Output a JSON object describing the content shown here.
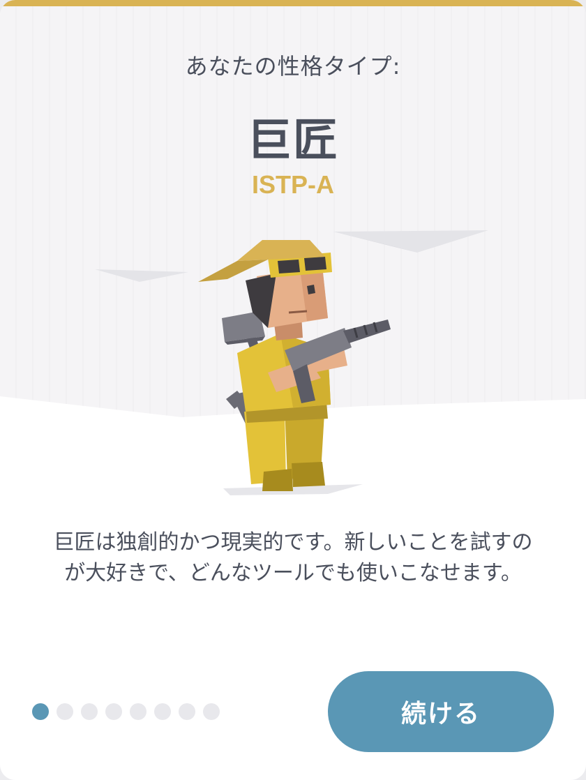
{
  "header": {
    "subtitle": "あなたの性格タイプ:",
    "type_name": "巨匠",
    "type_code": "ISTP-A"
  },
  "illustration": {
    "icon": "virtuoso-craftsman-illustration"
  },
  "description": {
    "line1": "巨匠は独創的かつ現実的です。新しいことを試すの",
    "line2": "が大好きで、どんなツールでも使いこなせます。"
  },
  "pagination": {
    "total": 8,
    "current": 1
  },
  "actions": {
    "continue_label": "続ける"
  },
  "colors": {
    "accent_gold": "#d9b354",
    "primary_blue": "#5a97b5",
    "text_dark": "#4a4f5c"
  }
}
